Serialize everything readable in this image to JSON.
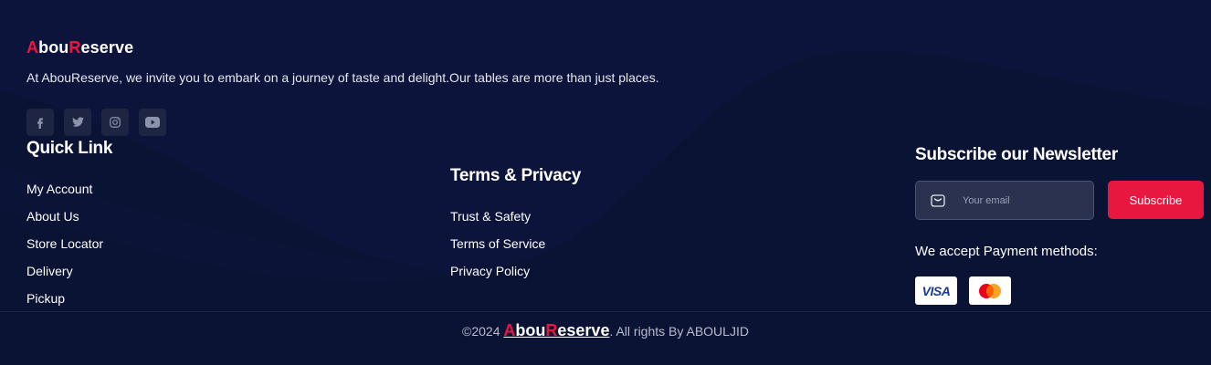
{
  "brand": {
    "first_initial": "A",
    "middle": "bou",
    "second_initial": "R",
    "rest": "eserve"
  },
  "tagline": "At AbouReserve, we invite you to embark on a journey of taste and delight.Our tables are more than just places.",
  "social": [
    {
      "icon": "facebook-icon"
    },
    {
      "icon": "twitter-icon"
    },
    {
      "icon": "instagram-icon"
    },
    {
      "icon": "youtube-icon"
    }
  ],
  "quick_link": {
    "title": "Quick Link",
    "items": [
      "My Account",
      "About Us",
      "Store Locator",
      "Delivery",
      "Pickup"
    ]
  },
  "terms": {
    "title": "Terms & Privacy",
    "items": [
      "Trust & Safety",
      "Terms of Service",
      "Privacy Policy"
    ]
  },
  "newsletter": {
    "title": "Subscribe our Newsletter",
    "email_placeholder": "Your email",
    "subscribe_label": "Subscribe"
  },
  "payment": {
    "label": "We accept Payment methods:",
    "visa_label": "VISA",
    "mastercard_icon": "mastercard-icon"
  },
  "copyright": {
    "prefix": "©2024",
    "suffix": ". All rights By ABOULJID"
  },
  "colors": {
    "background": "#0a1333",
    "accent": "#e8173f"
  }
}
